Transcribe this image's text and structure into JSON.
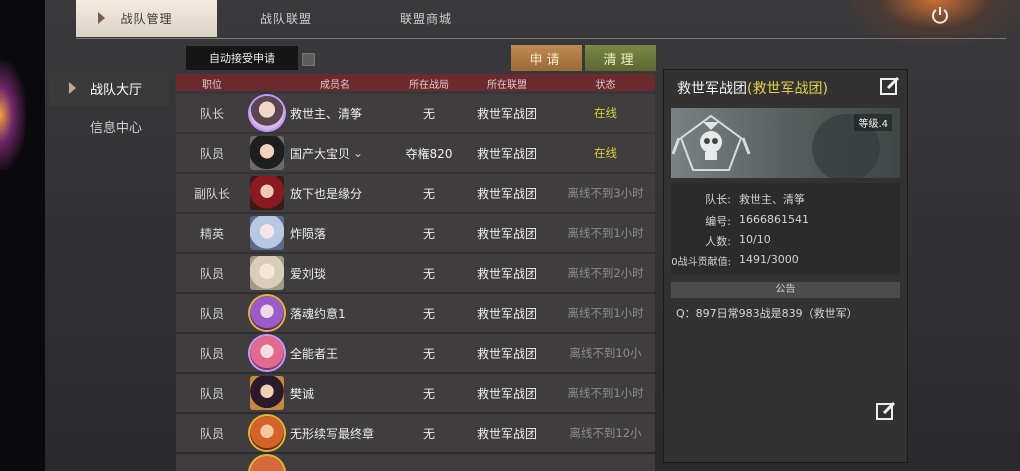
{
  "tabs": [
    {
      "label": "战队管理",
      "active": true
    },
    {
      "label": "战队联盟",
      "active": false
    },
    {
      "label": "联盟商城",
      "active": false
    }
  ],
  "side_nav": [
    {
      "label": "战队大厅",
      "active": true
    },
    {
      "label": "信息中心",
      "active": false
    }
  ],
  "controls": {
    "auto_accept_label": "自动接受申请",
    "auto_accept_checked": false,
    "apply_button": "申请",
    "clear_button": "清理"
  },
  "table": {
    "headers": [
      "职位",
      "成员名",
      "所在战局",
      "所在联盟",
      "状态"
    ],
    "rows": [
      {
        "role": "队长",
        "name": "救世主、清筝",
        "zone": "无",
        "league": "救世军战团",
        "status": "在线",
        "online": true
      },
      {
        "role": "队员",
        "name": "国产大宝贝",
        "zone": "夺権820",
        "league": "救世军战团",
        "status": "在线",
        "online": true
      },
      {
        "role": "副队长",
        "name": "放下也是缘分",
        "zone": "无",
        "league": "救世军战团",
        "status": "离线不到3小时",
        "online": false
      },
      {
        "role": "精英",
        "name": "炸陨落",
        "zone": "无",
        "league": "救世军战团",
        "status": "离线不到1小时",
        "online": false
      },
      {
        "role": "队员",
        "name": "爱刘琰",
        "zone": "无",
        "league": "救世军战团",
        "status": "离线不到2小时",
        "online": false
      },
      {
        "role": "队员",
        "name": "落魂约意1",
        "zone": "无",
        "league": "救世军战团",
        "status": "离线不到1小时",
        "online": false
      },
      {
        "role": "队员",
        "name": "全能者王",
        "zone": "无",
        "league": "救世军战团",
        "status": "离线不到10小",
        "online": false
      },
      {
        "role": "队员",
        "name": "樊诚",
        "zone": "无",
        "league": "救世军战团",
        "status": "离线不到1小时",
        "online": false
      },
      {
        "role": "队员",
        "name": "无形续写最终章",
        "zone": "无",
        "league": "救世军战团",
        "status": "离线不到12小",
        "online": false
      }
    ]
  },
  "team_panel": {
    "title_main": "救世军战团",
    "title_paren": "(救世军战团)",
    "level_label": "等级.4",
    "info": [
      {
        "label": "队长:",
        "value": "救世主、清筝"
      },
      {
        "label": "编号:",
        "value": "1666861541"
      },
      {
        "label": "人数:",
        "value": "10/10"
      },
      {
        "label": "0战斗贡献值:",
        "value": "1491/3000"
      }
    ],
    "notice_header": "公告",
    "notice_text": "Q：897日常983战是839（救世军）"
  },
  "colors": {
    "online": "#d8d23c",
    "offline": "#8d8d8d",
    "header_bar": "#6b2a2e",
    "apply": "#b07c45",
    "clear": "#6e7a3c"
  }
}
